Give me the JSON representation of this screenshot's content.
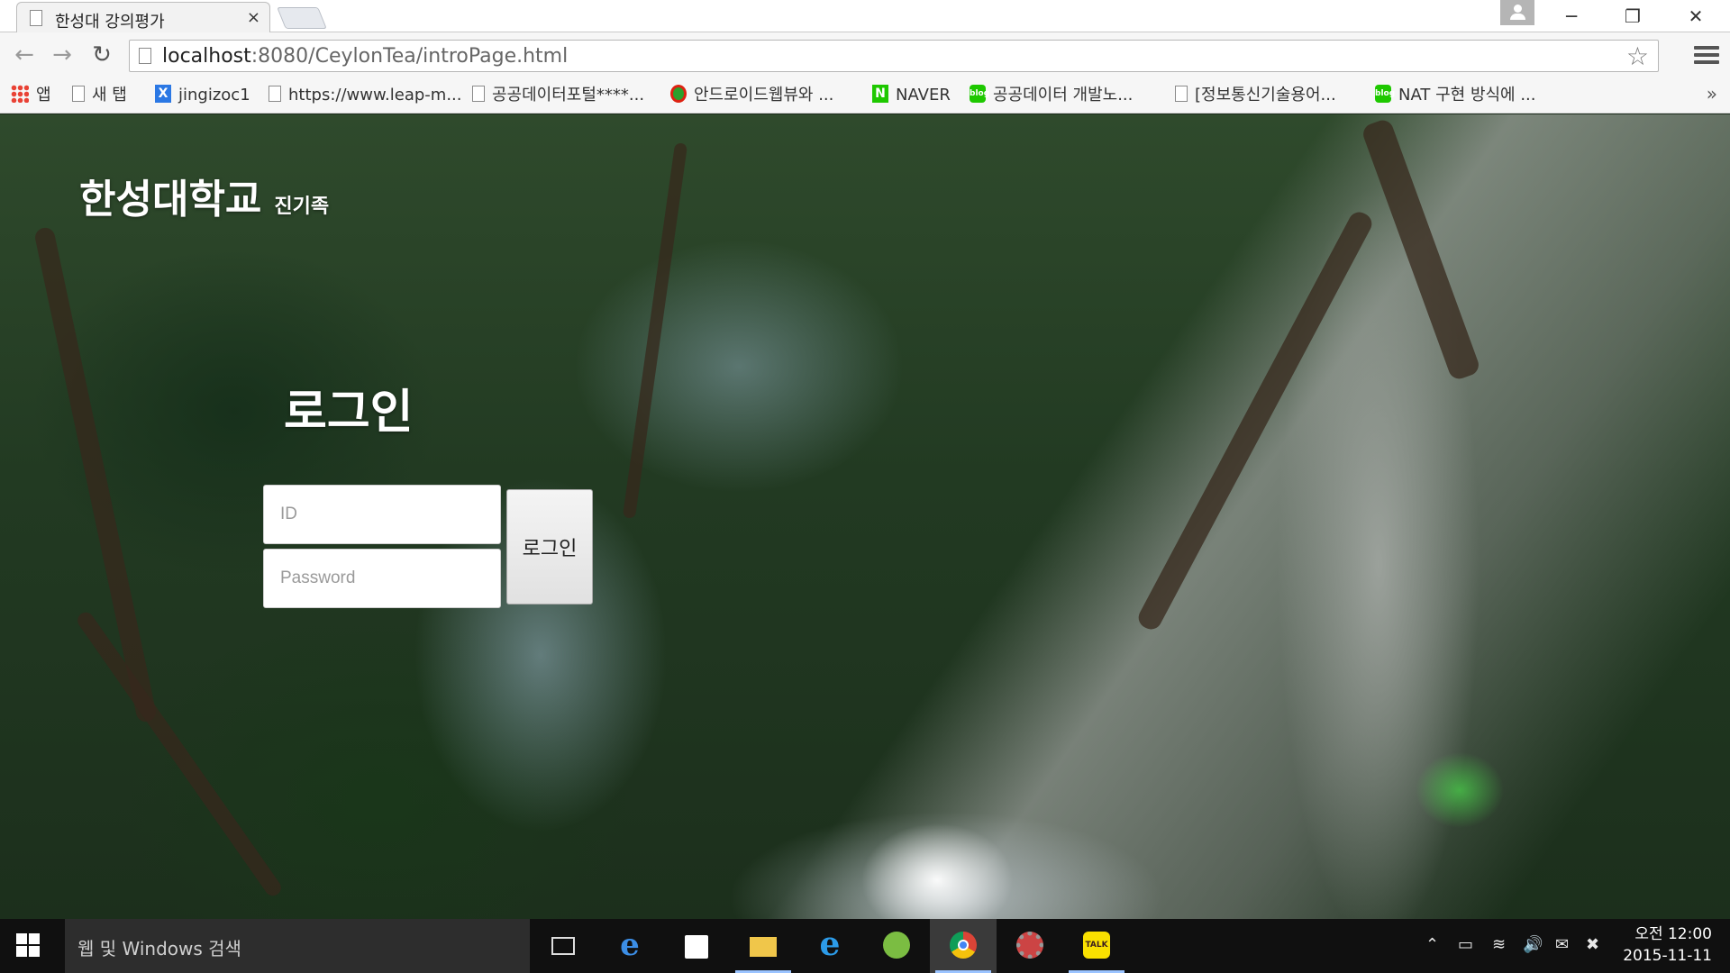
{
  "browser": {
    "tab_title": "한성대 강의평가",
    "tab_close": "×",
    "url_host": "localhost",
    "url_rest": ":8080/CeylonTea/introPage.html",
    "window_buttons": [
      "─",
      "❐",
      "✕"
    ],
    "bookmarks": [
      {
        "label": "앱",
        "icon": "apps-icon"
      },
      {
        "label": "새 탭",
        "icon": "page-icon"
      },
      {
        "label": "jingizoc1",
        "icon": "x-app-icon"
      },
      {
        "label": "https://www.leap-m...",
        "icon": "page-icon"
      },
      {
        "label": "공공데이터포털****...",
        "icon": "page-icon"
      },
      {
        "label": "안드로이드웹뷰와 ...",
        "icon": "circle-app-icon"
      },
      {
        "label": "NAVER",
        "icon": "naver-icon"
      },
      {
        "label": "공공데이터 개발노...",
        "icon": "blog-icon"
      },
      {
        "label": "[정보통신기술용어...",
        "icon": "page-icon"
      },
      {
        "label": "NAT 구현 방식에 ...",
        "icon": "blog-icon"
      }
    ],
    "bookmarks_more": "»"
  },
  "page": {
    "site_title": "한성대학교",
    "site_subtitle": "진기족",
    "login_heading": "로그인",
    "id_placeholder": "ID",
    "password_placeholder": "Password",
    "login_button": "로그인"
  },
  "taskbar": {
    "search_placeholder": "웹 및 Windows 검색",
    "apps": [
      "task-view",
      "edge",
      "store",
      "file-explorer",
      "internet-explorer",
      "android-studio",
      "chrome",
      "settings-gear-app",
      "kakaotalk"
    ],
    "time": "오전 12:00",
    "date": "2015-11-11"
  }
}
